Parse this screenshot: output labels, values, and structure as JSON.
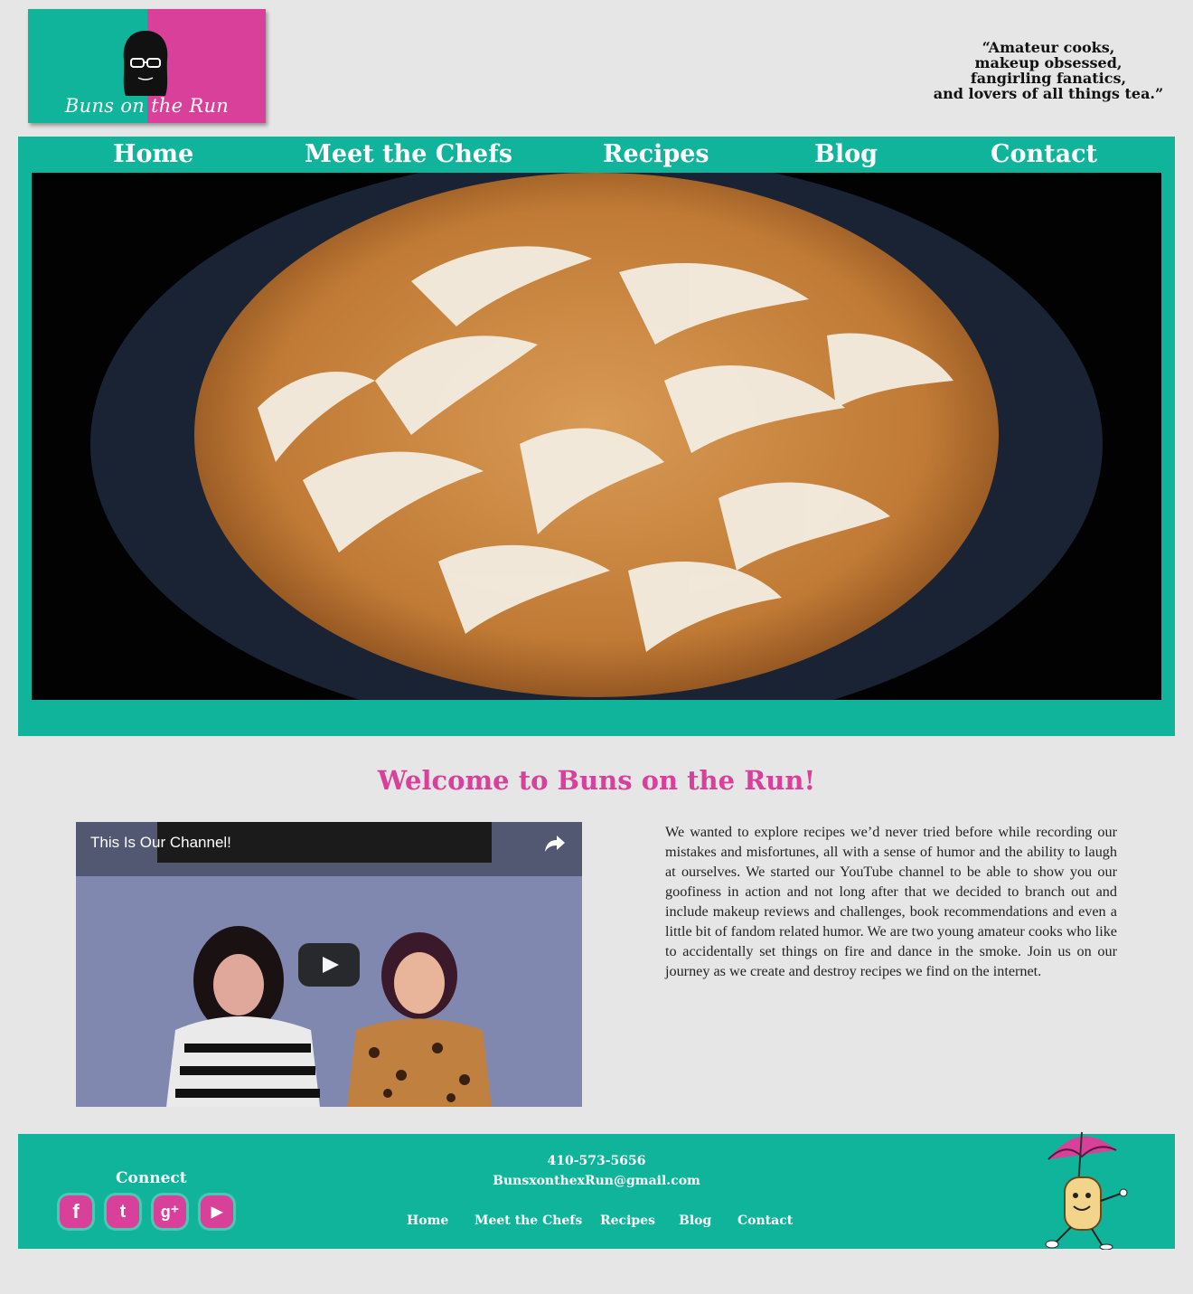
{
  "header": {
    "logo_text": "Buns on the Run",
    "tagline": [
      "“Amateur cooks,",
      "makeup obsessed,",
      "fangirling fanatics,",
      "and lovers of all things tea.”"
    ]
  },
  "nav": {
    "items": [
      {
        "label": "Home"
      },
      {
        "label": "Meet the Chefs"
      },
      {
        "label": "Recipes"
      },
      {
        "label": "Blog"
      },
      {
        "label": "Contact"
      }
    ]
  },
  "main": {
    "welcome_title": "Welcome to Buns on the Run!",
    "video": {
      "title": "This Is Our Channel!"
    },
    "about_text": "We wanted to explore recipes we’d never tried before while recording our mistakes and misfortunes, all with a sense of humor and the ability to laugh at ourselves. We started our YouTube channel to be able to show you our goofiness in action and not long after that we decided to branch out and include makeup reviews and challenges, book recommendations and even a little bit of fandom related humor. We are two young amateur cooks who like to accidentally set things on fire and dance in the smoke. Join us on our journey as we create and destroy recipes we find on the internet."
  },
  "footer": {
    "connect_label": "Connect",
    "social": [
      {
        "icon": "facebook-icon",
        "glyph": "f"
      },
      {
        "icon": "twitter-icon",
        "glyph": "t"
      },
      {
        "icon": "google-plus-icon",
        "glyph": "g⁺"
      },
      {
        "icon": "youtube-icon",
        "glyph": "▶"
      }
    ],
    "phone": "410-573-5656",
    "email": "BunsxonthexRun@gmail.com",
    "nav": [
      {
        "label": "Home"
      },
      {
        "label": "Meet the Chefs"
      },
      {
        "label": "Recipes"
      },
      {
        "label": "Blog"
      },
      {
        "label": "Contact"
      }
    ]
  },
  "colors": {
    "teal": "#10b49b",
    "pink": "#d9409a",
    "page_bg": "#e6e6e6"
  }
}
